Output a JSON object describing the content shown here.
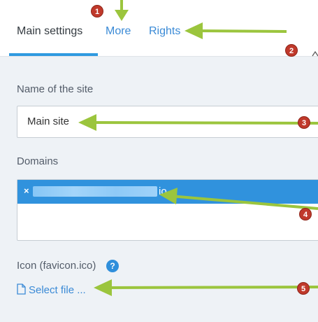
{
  "tabs": [
    {
      "label": "Main settings"
    },
    {
      "label": "More"
    },
    {
      "label": "Rights"
    }
  ],
  "form": {
    "site_name_label": "Name of the site",
    "site_name_value": "Main site",
    "domains_label": "Domains",
    "domain_chip_text": "io",
    "icon_label": "Icon (favicon.ico)",
    "help_glyph": "?",
    "select_file_label": "Select file ..."
  },
  "callouts": {
    "badge1": "1",
    "badge2": "2",
    "badge3": "3",
    "badge4": "4",
    "badge5": "5"
  },
  "colors": {
    "accent": "#2f9ae0",
    "arrow": "#9bc53d",
    "badge": "#c0392b"
  }
}
